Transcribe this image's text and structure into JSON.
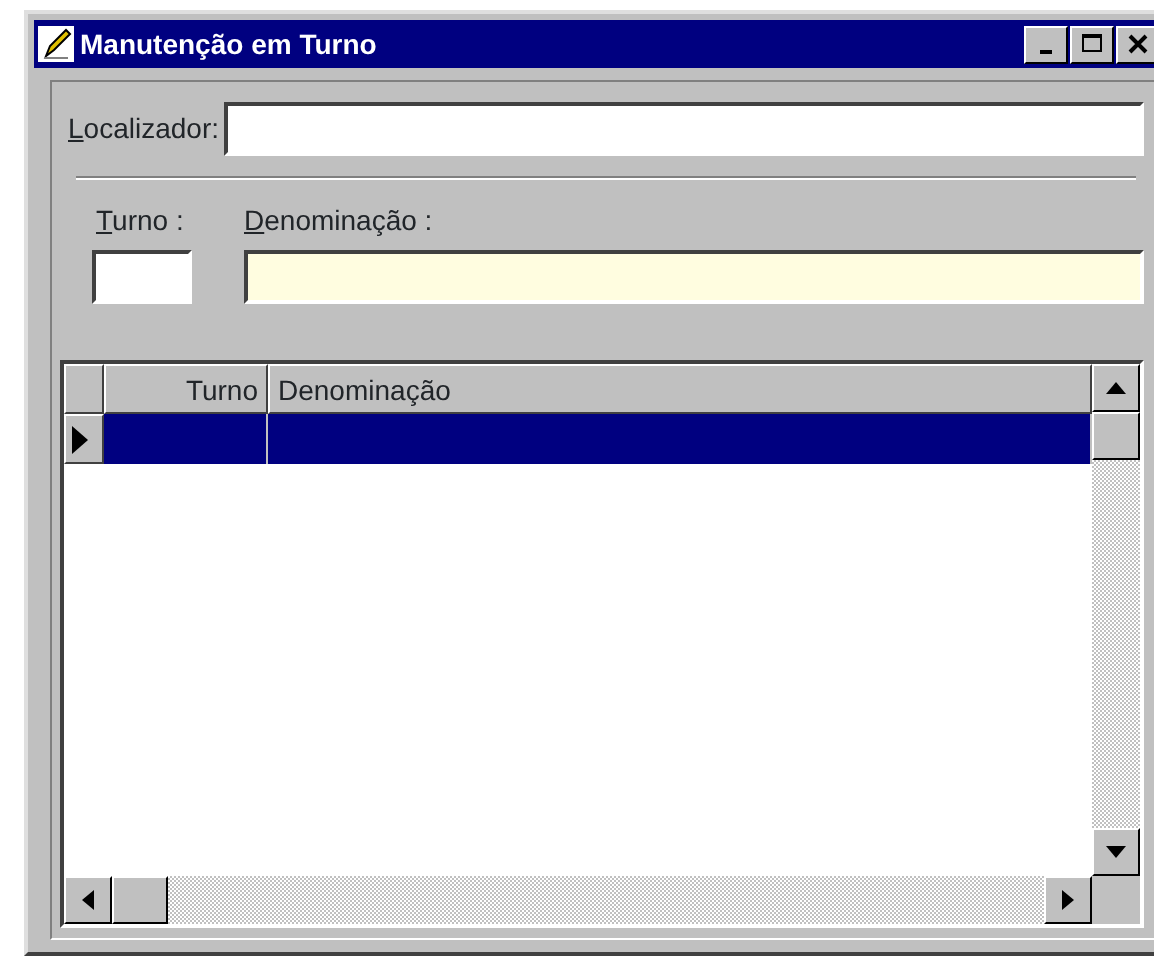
{
  "window": {
    "title": "Manutenção em Turno",
    "controls": [
      {
        "kind": "minimize"
      },
      {
        "kind": "maximize"
      },
      {
        "kind": "close"
      }
    ]
  },
  "locator": {
    "label": "Localizador:"
  },
  "fields": [
    {
      "label": "Turno :",
      "kind": "plain"
    },
    {
      "label": "Denominação :",
      "kind": "required"
    }
  ],
  "table": {
    "columns": [
      "Turno",
      "Denominação"
    ],
    "rows": [
      {
        "selected": true
      }
    ]
  }
}
